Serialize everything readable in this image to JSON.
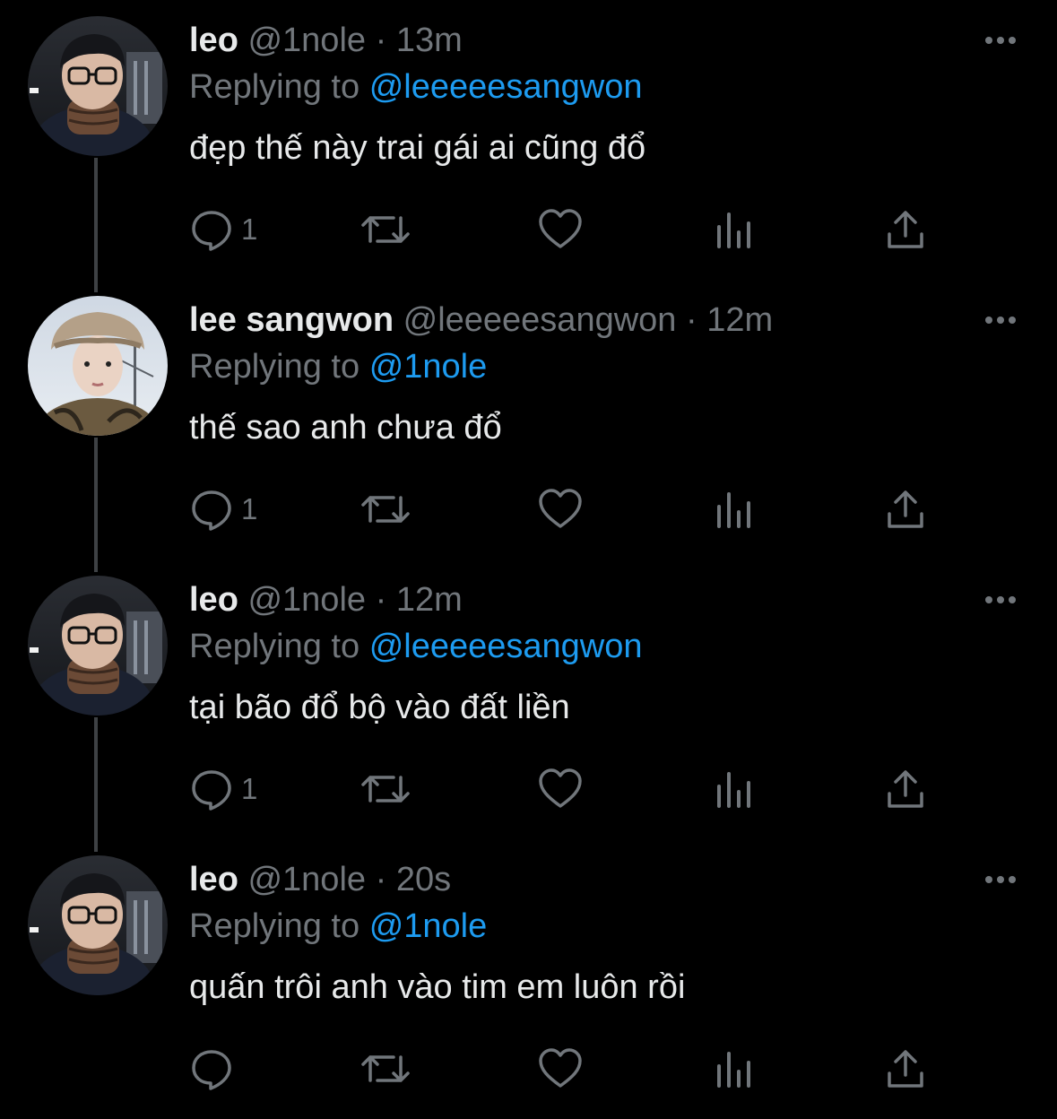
{
  "theme": {
    "background": "#000000",
    "text": "#e7e9ea",
    "muted": "#71767b",
    "link": "#1d9bf0",
    "thread_line": "#3e4144"
  },
  "tweets": [
    {
      "name": "leo",
      "handle": "@1nole",
      "separator": "·",
      "time": "13m",
      "replying_prefix": "Replying to",
      "replying_to": "@leeeeesangwon",
      "text": "đẹp thế này trai gái ai cũng đổ",
      "reply_count": "1",
      "avatar": "avatar-leo"
    },
    {
      "name": "lee sangwon",
      "handle": "@leeeeesangwon",
      "separator": "·",
      "time": "12m",
      "replying_prefix": "Replying to",
      "replying_to": "@1nole",
      "text": "thế sao anh chưa đổ",
      "reply_count": "1",
      "avatar": "avatar-sangwon"
    },
    {
      "name": "leo",
      "handle": "@1nole",
      "separator": "·",
      "time": "12m",
      "replying_prefix": "Replying to",
      "replying_to": "@leeeeesangwon",
      "text": "tại bão đổ bộ vào đất liền",
      "reply_count": "1",
      "avatar": "avatar-leo"
    },
    {
      "name": "leo",
      "handle": "@1nole",
      "separator": "·",
      "time": "20s",
      "replying_prefix": "Replying to",
      "replying_to": "@1nole",
      "text": "quấn trôi anh vào tim em luôn rồi",
      "reply_count": "",
      "avatar": "avatar-leo"
    }
  ],
  "icons": {
    "more": "more-horizontal-icon",
    "reply": "reply-bubble-icon",
    "retweet": "retweet-icon",
    "like": "heart-icon",
    "views": "views-bar-chart-icon",
    "share": "share-upload-icon"
  }
}
